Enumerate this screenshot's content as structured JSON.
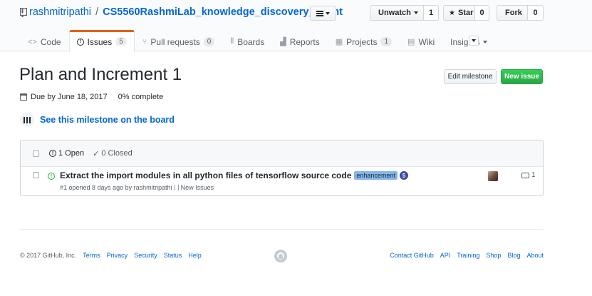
{
  "repo": {
    "owner": "rashmitripathi",
    "separator": "/",
    "name": "CS5560RashmiLab_knowledge_discovery_mgmt"
  },
  "pagehead_actions": [
    {
      "label": "Unwatch",
      "icon": "eye-icon",
      "count": "1"
    },
    {
      "label": "Star",
      "icon": "star-icon",
      "count": "0"
    },
    {
      "label": "Fork",
      "icon": "fork-icon",
      "count": "0"
    }
  ],
  "tabs": [
    {
      "label": "Code",
      "icon": "code-icon",
      "counter": ""
    },
    {
      "label": "Issues",
      "icon": "issue-icon",
      "counter": "5",
      "selected": true
    },
    {
      "label": "Pull requests",
      "icon": "pull-request-icon",
      "counter": "0"
    },
    {
      "label": "Boards",
      "icon": "boards-icon",
      "counter": ""
    },
    {
      "label": "Reports",
      "icon": "reports-icon",
      "counter": ""
    },
    {
      "label": "Projects",
      "icon": "project-icon",
      "counter": "1"
    },
    {
      "label": "Wiki",
      "icon": "wiki-icon",
      "counter": ""
    },
    {
      "label": "Insights",
      "icon": "",
      "counter": ""
    }
  ],
  "milestone": {
    "title": "Plan and Increment 1",
    "due": "Due by June 18, 2017",
    "progress": "0% complete",
    "board_link": "See this milestone on the board",
    "edit_label": "Edit milestone",
    "new_issue_label": "New issue"
  },
  "issues_header": {
    "open": "1 Open",
    "closed": "0 Closed"
  },
  "issues": [
    {
      "title": "Extract the import modules in all python files of tensorflow source code",
      "label": "enhancement",
      "label_color": "#84b6eb",
      "badge": "5",
      "number_text": "#1 opened 8 days ago by rashmitripathi",
      "milestone": "New Issues",
      "comments": "1"
    }
  ],
  "footer": {
    "copyright": "© 2017 GitHub, Inc.",
    "left_links": [
      "Terms",
      "Privacy",
      "Security",
      "Status",
      "Help"
    ],
    "right_links": [
      "Contact GitHub",
      "API",
      "Training",
      "Shop",
      "Blog",
      "About"
    ]
  }
}
